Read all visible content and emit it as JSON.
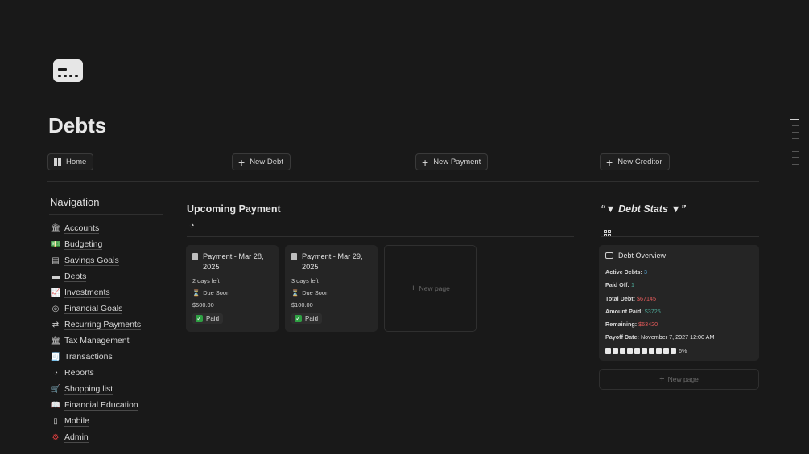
{
  "page": {
    "title": "Debts",
    "icon": "credit-card-icon"
  },
  "buttons": {
    "home": "Home",
    "new_debt": "New Debt",
    "new_payment": "New Payment",
    "new_creditor": "New Creditor"
  },
  "navigation": {
    "title": "Navigation",
    "items": [
      {
        "label": "Accounts",
        "icon": "bank-icon"
      },
      {
        "label": "Budgeting",
        "icon": "money-icon"
      },
      {
        "label": "Savings Goals",
        "icon": "wallet-icon"
      },
      {
        "label": "Debts",
        "icon": "credit-card-icon"
      },
      {
        "label": "Investments",
        "icon": "chart-icon"
      },
      {
        "label": "Financial Goals",
        "icon": "target-icon"
      },
      {
        "label": "Recurring Payments",
        "icon": "repeat-icon"
      },
      {
        "label": "Tax Management",
        "icon": "bank-icon"
      },
      {
        "label": "Transactions",
        "icon": "receipt-icon"
      },
      {
        "label": "Reports",
        "icon": "pie-chart-icon"
      },
      {
        "label": "Shopping list",
        "icon": "cart-icon"
      },
      {
        "label": "Financial Education",
        "icon": "book-icon"
      },
      {
        "label": "Mobile",
        "icon": "phone-icon"
      },
      {
        "label": "Admin",
        "icon": "gear-icon",
        "color": "#e03e3e"
      }
    ]
  },
  "upcoming": {
    "title": "Upcoming Payment",
    "cards": [
      {
        "title": "Payment - Mar 28, 2025",
        "days_left": "2 days left",
        "status": "Due Soon",
        "amount": "$500.00",
        "paid_label": "Paid"
      },
      {
        "title": "Payment - Mar 29, 2025",
        "days_left": "3 days left",
        "status": "Due Soon",
        "amount": "$100.00",
        "paid_label": "Paid"
      }
    ],
    "new_page": "New page"
  },
  "stats": {
    "title": "“▼ Debt Stats ▼”",
    "card_title": "Debt Overview",
    "rows": {
      "active_debts_label": "Active Debts:",
      "active_debts_value": "3",
      "paid_off_label": "Paid Off:",
      "paid_off_value": "1",
      "total_debt_label": "Total Debt:",
      "total_debt_value": "$67145",
      "amount_paid_label": "Amount Paid:",
      "amount_paid_value": "$3725",
      "remaining_label": "Remaining:",
      "remaining_value": "$63420",
      "payoff_label": "Payoff Date:",
      "payoff_value": "November 7, 2027 12:00 AM",
      "progress_text": "6%"
    },
    "progress_fraction": 0.06,
    "new_page": "New page"
  },
  "colors": {
    "background": "#191919",
    "blue": "#529cca",
    "green": "#4dab9a",
    "red": "#e55b5b",
    "check_green": "#2ea043"
  }
}
